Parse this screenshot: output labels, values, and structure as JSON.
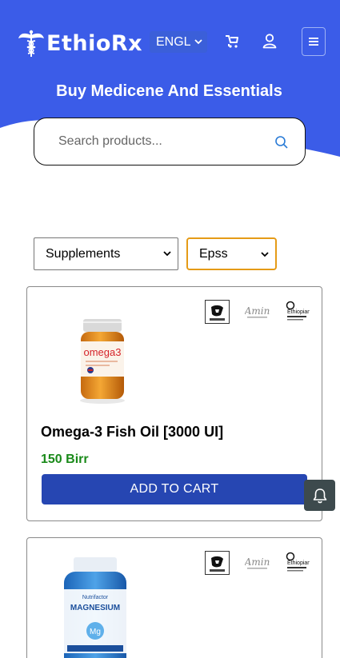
{
  "header": {
    "brand": "EthioRx",
    "language": "ENGL",
    "icons": [
      "caduceus-logo-icon",
      "cart-icon",
      "user-icon",
      "hamburger-menu-icon"
    ]
  },
  "hero": {
    "title": "Buy Medicene And Essentials",
    "background": "#3b5ce8"
  },
  "search": {
    "placeholder": "Search products..."
  },
  "filters": {
    "category": "Supplements",
    "store": "Epss"
  },
  "pharmacies": [
    "Eri logo",
    "Amin",
    "Ethiopian Pharmaceuticals"
  ],
  "products": [
    {
      "name": "Omega-3 Fish Oil [3000 UI]",
      "price": "150 Birr",
      "button": "ADD TO CART",
      "label": "omega3"
    },
    {
      "name": "",
      "price": "",
      "button": "",
      "label": "MAGNESIUM"
    }
  ],
  "colors": {
    "primary": "#3b5ce8",
    "button": "#2646b2",
    "price": "#1a8a1a",
    "store_border": "#e59b17"
  },
  "floating": {
    "icon": "bell-icon"
  }
}
